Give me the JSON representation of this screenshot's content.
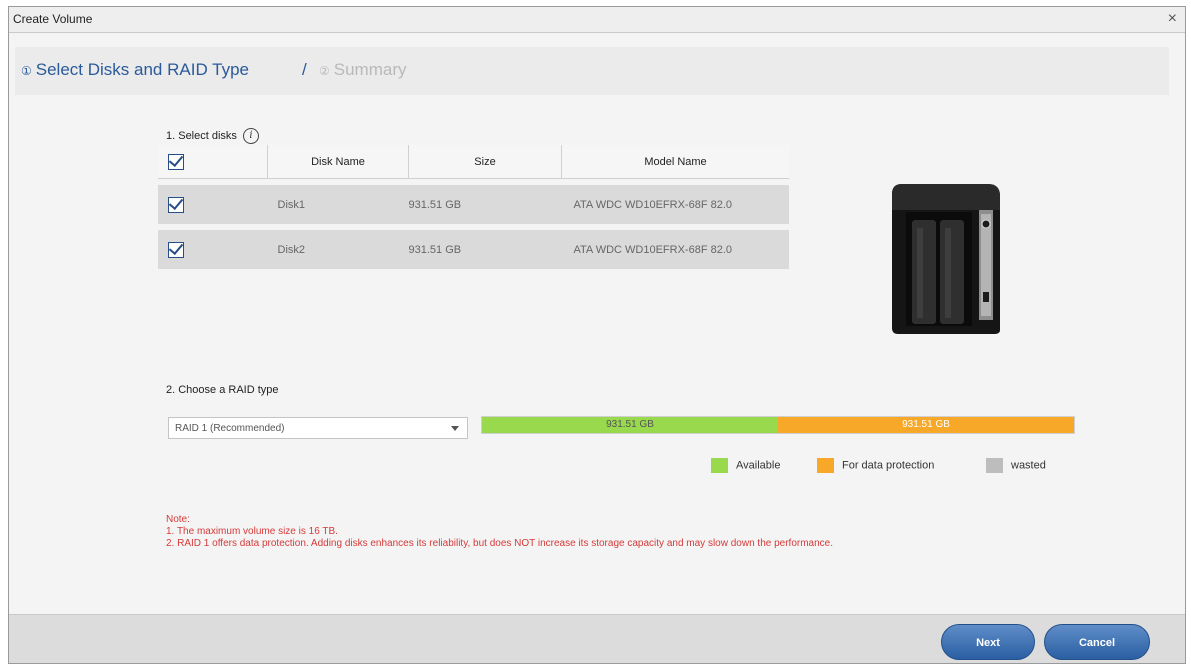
{
  "window": {
    "title": "Create Volume",
    "close_glyph": "×"
  },
  "steps": {
    "step1_num": "①",
    "step1_label": "Select Disks and RAID Type",
    "separator": "/",
    "step2_num": "②",
    "step2_label": "Summary"
  },
  "select_disks": {
    "label": "1. Select disks",
    "info_glyph": "i",
    "columns": [
      "Disk Name",
      "Size",
      "Model Name"
    ],
    "rows": [
      {
        "name": "Disk1",
        "size": "931.51 GB",
        "model": "ATA WDC WD10EFRX-68F 82.0",
        "checked": true
      },
      {
        "name": "Disk2",
        "size": "931.51 GB",
        "model": "ATA WDC WD10EFRX-68F 82.0",
        "checked": true
      }
    ],
    "all_checked": true
  },
  "raid": {
    "label": "2. Choose a RAID type",
    "selected": "RAID 1  (Recommended)",
    "available_value": "931.51 GB",
    "protection_value": "931.51 GB",
    "available_fraction": 0.5,
    "protection_fraction": 0.5
  },
  "legend": {
    "available": "Available",
    "protection": "For data protection",
    "wasted": "wasted",
    "colors": {
      "available": "#99d94d",
      "protection": "#f7a828",
      "wasted": "#bdbdbd"
    }
  },
  "note": {
    "heading": "Note:",
    "line1": "1. The maximum volume size is 16 TB.",
    "line2": "2. RAID 1 offers data protection. Adding disks enhances its reliability, but does NOT increase its storage capacity and may slow down the performance."
  },
  "buttons": {
    "next": "Next",
    "cancel": "Cancel"
  }
}
